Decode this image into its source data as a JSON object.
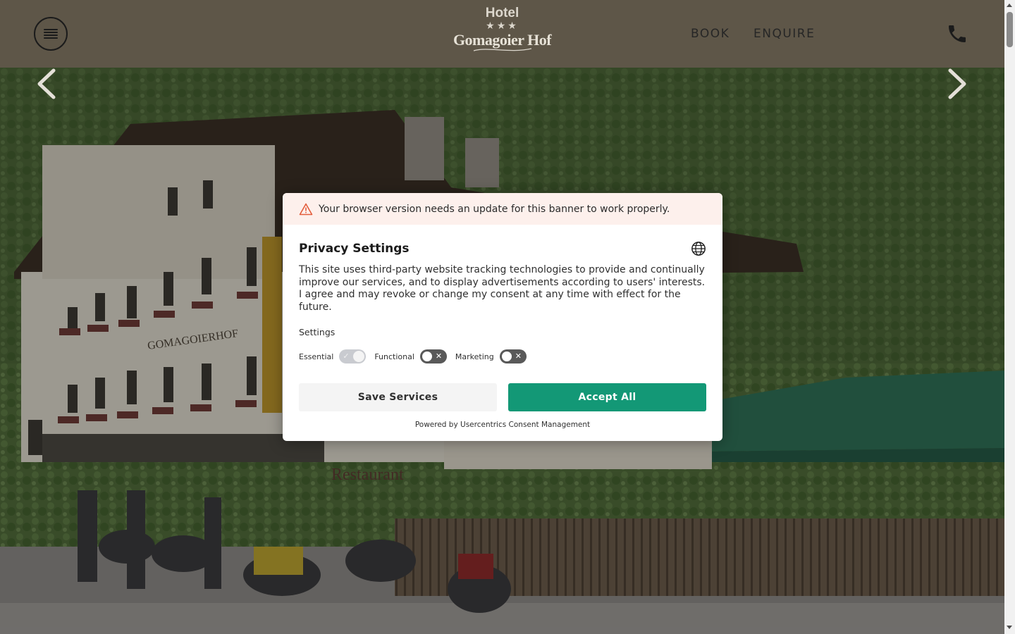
{
  "header": {
    "logo": {
      "line1": "Hotel",
      "stars": "★★★",
      "name": "Gomagoier Hof"
    },
    "nav": {
      "book": "BOOK",
      "enquire": "ENQUIRE"
    },
    "icons": {
      "menu": "hamburger-menu-icon",
      "phone": "phone-icon"
    }
  },
  "hero": {
    "building_sign": "GOMAGOIERHOF",
    "restaurant_sign": "Restaurant",
    "prev_icon": "chevron-left-icon",
    "next_icon": "chevron-right-icon"
  },
  "consent": {
    "warning_icon": "warning-triangle-icon",
    "warning_text": "Your browser version needs an update for this banner to work properly.",
    "title": "Privacy Settings",
    "language_icon": "globe-icon",
    "description": "This site uses third-party website tracking technologies to provide and continually improve our services, and to display advertisements according to users' interests. I agree and may revoke or change my consent at any time with effect for the future.",
    "settings_label": "Settings",
    "toggles": [
      {
        "label": "Essential",
        "state": "on"
      },
      {
        "label": "Functional",
        "state": "off"
      },
      {
        "label": "Marketing",
        "state": "off"
      }
    ],
    "save_label": "Save Services",
    "accept_label": "Accept All",
    "powered_by": "Powered by Usercentrics Consent Management"
  },
  "colors": {
    "header_bg": "#5e5648",
    "accept_button": "#139876",
    "warning_bg": "#fdf0ec",
    "warning_icon": "#e35d3c"
  }
}
